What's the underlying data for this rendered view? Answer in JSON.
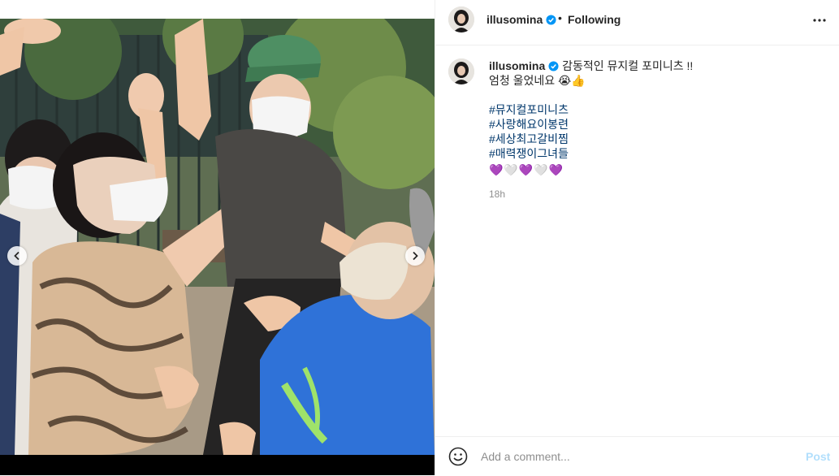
{
  "colors": {
    "link_hashtag": "#00376b",
    "post_button_disabled": "#b2dffc",
    "verified_badge": "#0095f6",
    "secondary_text": "#8e8e8e",
    "divider": "#efefef"
  },
  "icons": {
    "verified": "verified-badge-icon",
    "more": "more-horizontal-icon",
    "emoji": "emoji-smile-icon",
    "prev": "chevron-left-icon",
    "next": "chevron-right-icon"
  },
  "carousel": {
    "total_slides": 7,
    "active_slide_index": 3
  },
  "header": {
    "username": "illusomina",
    "separator": "•",
    "follow_status": "Following"
  },
  "caption": {
    "username": "illusomina",
    "line1": "감동적인 뮤지컬 포미니츠 !!",
    "line2": "엄청 울었네요 😭👍",
    "hashtags": [
      "#뮤지컬포미니츠",
      "#사랑해요이봉련",
      "#세상최고갈비찜",
      "#매력쟁이그녀들"
    ],
    "hearts": "💜🤍💜🤍💜",
    "time": "18h"
  },
  "footer": {
    "comment_placeholder": "Add a comment...",
    "post_label": "Post"
  }
}
